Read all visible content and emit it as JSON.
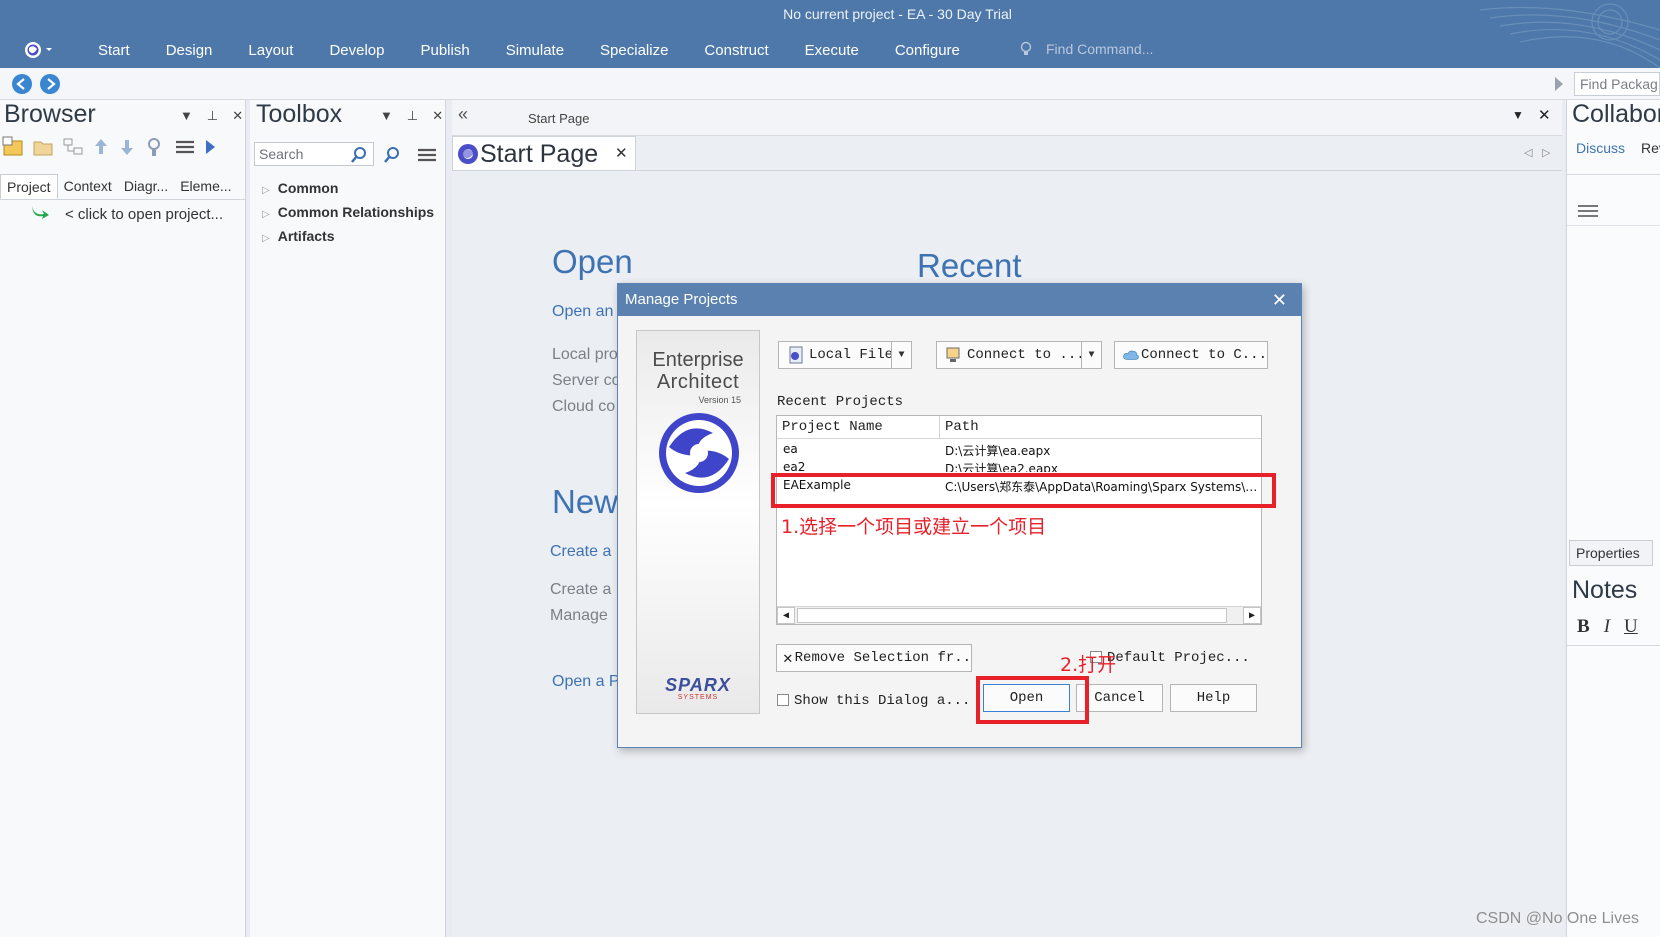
{
  "window": {
    "title": "No current project - EA - 30 Day Trial"
  },
  "ribbon": {
    "menu": [
      "Start",
      "Design",
      "Layout",
      "Develop",
      "Publish",
      "Simulate",
      "Specialize",
      "Construct",
      "Execute",
      "Configure"
    ],
    "find_command": "Find Command..."
  },
  "toolbar": {
    "find_package": "Find Packag"
  },
  "browser": {
    "title": "Browser",
    "tabs": [
      "Project",
      "Context",
      "Diagr...",
      "Eleme..."
    ],
    "empty_text": "< click to open project..."
  },
  "toolbox": {
    "title": "Toolbox",
    "search_placeholder": "Search",
    "items": [
      "Common",
      "Common Relationships",
      "Artifacts"
    ]
  },
  "main": {
    "breadcrumb": "Start Page",
    "tab_label": "Start Page",
    "open_heading": "Open",
    "open_link": "Open an",
    "open_items": [
      "Local pro",
      "Server co",
      "Cloud co"
    ],
    "recent_heading": "Recent",
    "new_heading": "New",
    "create_link": "Create a",
    "new_items": [
      "Create a",
      "Manage"
    ],
    "open_a": "Open a P"
  },
  "collab": {
    "title": "Collabor",
    "tabs": [
      "Discuss",
      "Rev"
    ],
    "properties_tab": "Properties",
    "notes_title": "Notes",
    "format_buttons": [
      "B",
      "I",
      "U"
    ]
  },
  "dialog": {
    "title": "Manage Projects",
    "splash": {
      "line1": "Enterprise",
      "line2": "Architect",
      "version": "Version 15",
      "brand": "SPARX",
      "brand_sub": "SYSTEMS"
    },
    "buttons": {
      "local_file": "Local File",
      "connect_to": "Connect to ...",
      "connect_cloud": "Connect to C...",
      "remove_selection": "Remove Selection fr...",
      "default_project": "Default Projec...",
      "show_dialog": "Show this Dialog a...",
      "open": "Open",
      "cancel": "Cancel",
      "help": "Help"
    },
    "recent_label": "Recent Projects",
    "columns": [
      "Project Name",
      "Path"
    ],
    "rows": [
      {
        "name": "ea",
        "path": "D:\\云计算\\ea.eapx"
      },
      {
        "name": "ea2",
        "path": "D:\\云计算\\ea2.eapx"
      },
      {
        "name": "EAExample",
        "path": "C:\\Users\\郑东泰\\AppData\\Roaming\\Sparx Systems\\EA\\EAExample.qea"
      }
    ],
    "selected_row": 2
  },
  "annotations": {
    "step1": "1.选择一个项目或建立一个项目",
    "step2": "2.打开"
  },
  "watermark": "CSDN @No One Lives",
  "colors": {
    "ribbon": "#4d78a9",
    "accent_blue": "#3e73b3",
    "annotation_red": "#e8202a"
  }
}
